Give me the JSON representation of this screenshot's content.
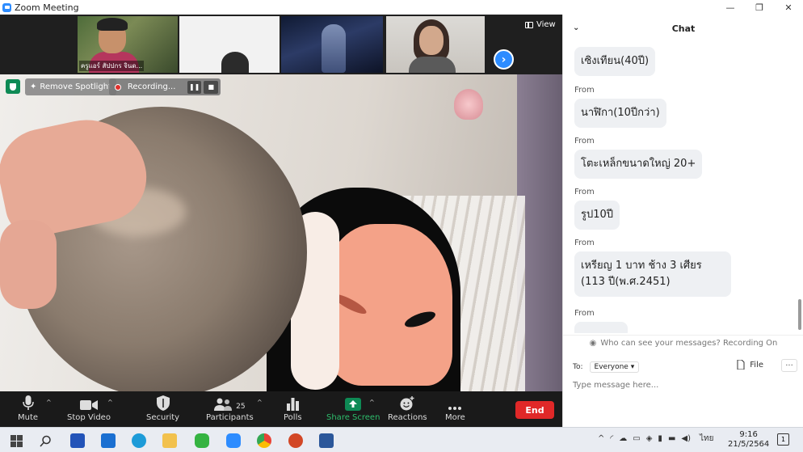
{
  "window": {
    "title": "Zoom Meeting",
    "minimize": "—",
    "maximize": "❐",
    "close": "✕"
  },
  "gallery": {
    "participants": [
      {
        "name": "ครูแอร์ สัปปกร จินด..."
      },
      {
        "name": ""
      },
      {
        "name": ""
      },
      {
        "name": ""
      }
    ],
    "view_label": "View"
  },
  "video_overlay": {
    "remove_spotlight": "Remove Spotlight",
    "recording": "Recording..."
  },
  "controls": {
    "mute": "Mute",
    "stop_video": "Stop Video",
    "security": "Security",
    "participants": "Participants",
    "participant_count": "25",
    "polls": "Polls",
    "share_screen": "Share Screen",
    "reactions": "Reactions",
    "more": "More",
    "end": "End"
  },
  "chat": {
    "title": "Chat",
    "messages": [
      {
        "from": "",
        "text": "เซิงเทียน(40ปี)"
      },
      {
        "from": "From",
        "text": "นาฬิกา(10ปีกว่า)"
      },
      {
        "from": "From",
        "text": "โตะเหล็กขนาดใหญ่ 20+"
      },
      {
        "from": "From",
        "text": "รูป10ปี"
      },
      {
        "from": "From",
        "text": "เหรียญ 1 บาท ช้าง 3 เศียร (113 ปี(พ.ศ.2451)"
      },
      {
        "from": "From",
        "text": ""
      }
    ],
    "who_can_see": "Who can see your messages? Recording On",
    "to_label": "To:",
    "to_value": "Everyone",
    "file_label": "File",
    "input_placeholder": "Type message here..."
  },
  "taskbar": {
    "time": "9:16",
    "date": "21/5/2564",
    "language": "ไทย",
    "notification_count": "1"
  },
  "colors": {
    "accent": "#2d8cff",
    "end": "#e02828",
    "share": "#0e8a55"
  }
}
